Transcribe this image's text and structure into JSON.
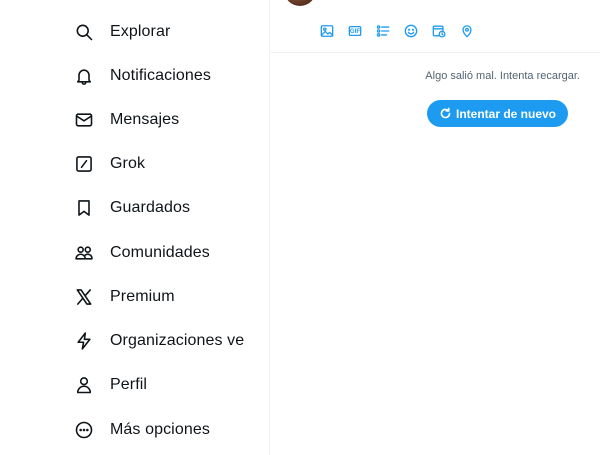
{
  "sidebar": {
    "items": [
      {
        "label": "Explorar",
        "icon": "search-icon"
      },
      {
        "label": "Notificaciones",
        "icon": "bell-icon"
      },
      {
        "label": "Mensajes",
        "icon": "envelope-icon"
      },
      {
        "label": "Grok",
        "icon": "grok-icon"
      },
      {
        "label": "Guardados",
        "icon": "bookmark-icon"
      },
      {
        "label": "Comunidades",
        "icon": "communities-icon"
      },
      {
        "label": "Premium",
        "icon": "x-logo-icon"
      },
      {
        "label": "Organizaciones ver",
        "icon": "lightning-icon"
      },
      {
        "label": "Perfil",
        "icon": "person-icon"
      },
      {
        "label": "Más opciones",
        "icon": "more-circle-icon"
      }
    ]
  },
  "composer": {
    "tools": [
      "image-icon",
      "gif-icon",
      "poll-icon",
      "emoji-icon",
      "schedule-icon",
      "location-icon"
    ],
    "gif_label": "GIF"
  },
  "error": {
    "message": "Algo salió mal. Intenta recargar.",
    "retry_label": "Intentar de nuevo"
  },
  "colors": {
    "accent": "#1d9bf0",
    "text": "#0f1419",
    "muted": "#536471"
  }
}
